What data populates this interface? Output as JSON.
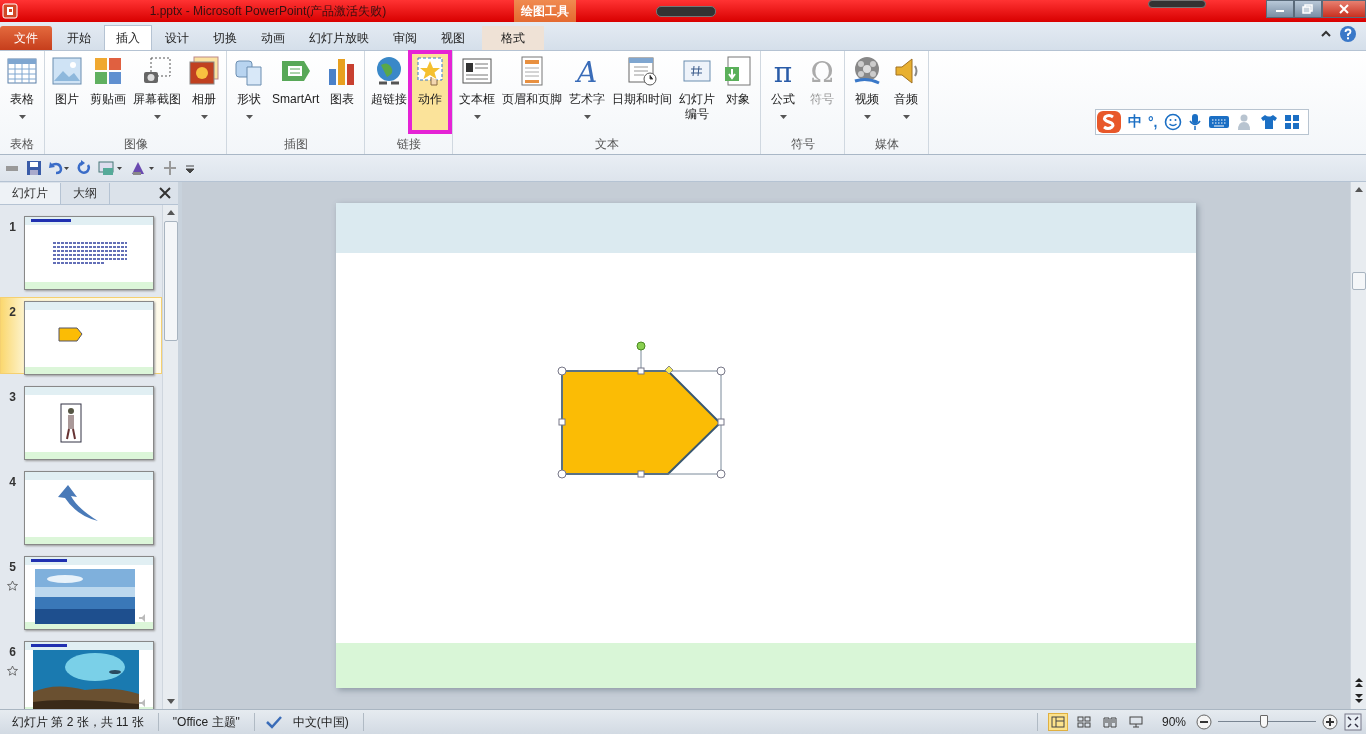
{
  "window": {
    "title": "1.pptx  -  Microsoft PowerPoint(产品激活失败)",
    "context_tab_group": "绘图工具"
  },
  "tabs": [
    {
      "label": "文件",
      "kind": "file",
      "selected": false
    },
    {
      "label": "开始",
      "kind": "normal",
      "selected": false
    },
    {
      "label": "插入",
      "kind": "normal",
      "selected": true
    },
    {
      "label": "设计",
      "kind": "normal",
      "selected": false
    },
    {
      "label": "切换",
      "kind": "normal",
      "selected": false
    },
    {
      "label": "动画",
      "kind": "normal",
      "selected": false
    },
    {
      "label": "幻灯片放映",
      "kind": "normal",
      "selected": false
    },
    {
      "label": "审阅",
      "kind": "normal",
      "selected": false
    },
    {
      "label": "视图",
      "kind": "normal",
      "selected": false
    },
    {
      "label": "格式",
      "kind": "context",
      "selected": false
    }
  ],
  "ribbon": {
    "groups": [
      {
        "label": "表格",
        "buttons": [
          {
            "label": "表格",
            "kind": "table",
            "dropdown": true
          }
        ]
      },
      {
        "label": "图像",
        "buttons": [
          {
            "label": "图片",
            "kind": "picture"
          },
          {
            "label": "剪贴画",
            "kind": "clipart"
          },
          {
            "label": "屏幕截图",
            "kind": "screenshot",
            "dropdown": true
          },
          {
            "label": "相册",
            "kind": "album",
            "dropdown": true
          }
        ]
      },
      {
        "label": "插图",
        "buttons": [
          {
            "label": "形状",
            "kind": "shapes",
            "dropdown": true
          },
          {
            "label": "SmartArt",
            "kind": "smartart"
          },
          {
            "label": "图表",
            "kind": "chart"
          }
        ]
      },
      {
        "label": "链接",
        "buttons": [
          {
            "label": "超链接",
            "kind": "hyperlink"
          },
          {
            "label": "动作",
            "kind": "action",
            "highlighted": true
          }
        ]
      },
      {
        "label": "文本",
        "buttons": [
          {
            "label": "文本框",
            "kind": "textbox",
            "dropdown": true
          },
          {
            "label": "页眉和页脚",
            "kind": "headerfooter"
          },
          {
            "label": "艺术字",
            "kind": "wordart",
            "glyph": "A",
            "dropdown": true
          },
          {
            "label": "日期和时间",
            "kind": "datetime"
          },
          {
            "label": "幻灯片编号",
            "kind": "slidenumber"
          },
          {
            "label": "对象",
            "kind": "object"
          }
        ]
      },
      {
        "label": "符号",
        "buttons": [
          {
            "label": "公式",
            "kind": "equation",
            "glyph": "π",
            "dropdown": true
          },
          {
            "label": "符号",
            "kind": "symbol",
            "glyph": "Ω",
            "disabled": true
          }
        ]
      },
      {
        "label": "媒体",
        "buttons": [
          {
            "label": "视频",
            "kind": "video",
            "dropdown": true
          },
          {
            "label": "音频",
            "kind": "audio",
            "dropdown": true
          }
        ]
      }
    ]
  },
  "ime_toolbar": {
    "mode": "中",
    "punctuation": "°,"
  },
  "panel": {
    "tabs": [
      {
        "label": "幻灯片",
        "selected": true
      },
      {
        "label": "大纲",
        "selected": false
      }
    ]
  },
  "slides": [
    {
      "number": "1",
      "kind": "text",
      "selected": false,
      "animated": false
    },
    {
      "number": "2",
      "kind": "shape",
      "selected": true,
      "animated": false
    },
    {
      "number": "3",
      "kind": "figure",
      "selected": false,
      "animated": false
    },
    {
      "number": "4",
      "kind": "arrow",
      "selected": false,
      "animated": false
    },
    {
      "number": "5",
      "kind": "picture",
      "selected": false,
      "animated": true
    },
    {
      "number": "6",
      "kind": "picture",
      "selected": false,
      "animated": true
    }
  ],
  "canvas": {
    "shape": {
      "selected": true
    }
  },
  "status_bar": {
    "slide_info": "幻灯片 第 2 张，共 11 张",
    "theme": "\"Office 主题\"",
    "language": "中文(中国)",
    "views": [
      {
        "selected": true
      },
      {
        "selected": false
      },
      {
        "selected": false
      },
      {
        "selected": false
      }
    ],
    "zoom": "90%",
    "zoom_slider": {
      "level": 0.47
    }
  }
}
